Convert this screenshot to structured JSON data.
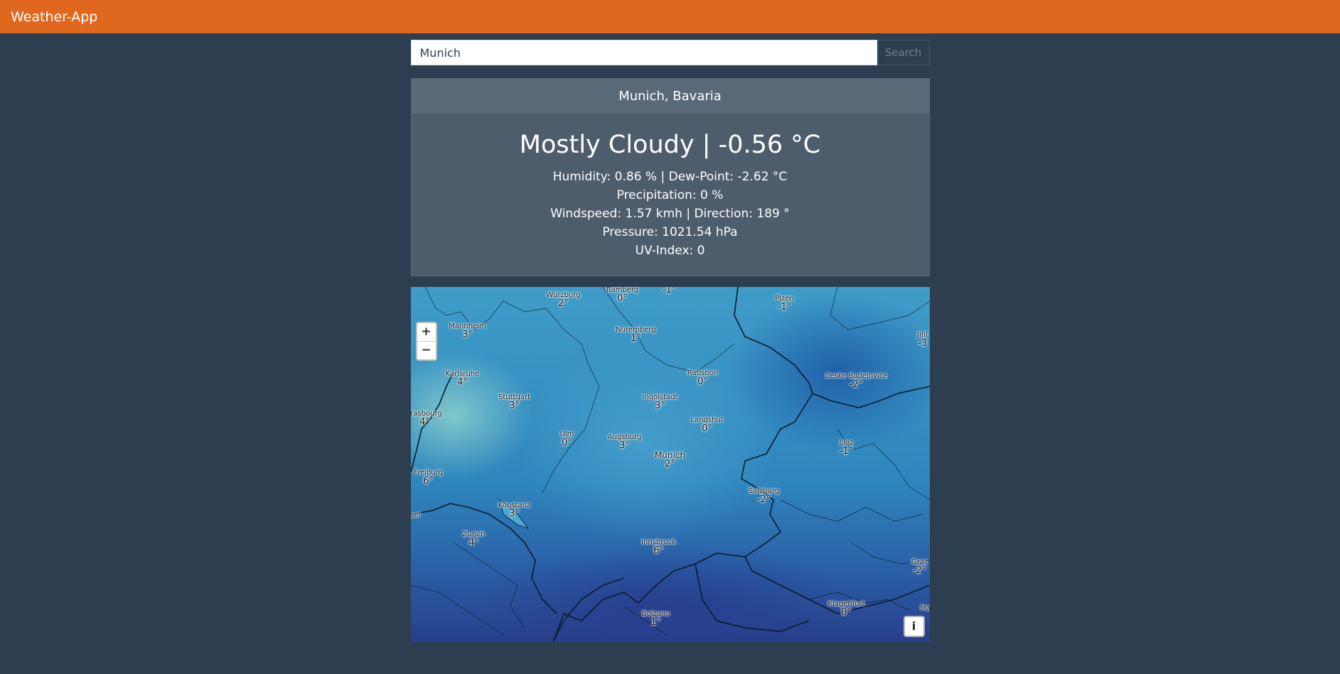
{
  "navbar": {
    "brand": "Weather-App"
  },
  "search": {
    "value": "Munich",
    "button_label": "Search"
  },
  "weather": {
    "location": "Munich, Bavaria",
    "summary": "Mostly Cloudy | -0.56 °C",
    "humidity_line": "Humidity: 0.86 % | Dew-Point: -2.62 °C",
    "precipitation_line": "Precipitation: 0 %",
    "wind_line": "Windspeed: 1.57 kmh | Direction: 189 °",
    "pressure_line": "Pressure: 1021.54 hPa",
    "uv_line": "UV-Index: 0"
  },
  "map": {
    "zoom_in_label": "+",
    "zoom_out_label": "−",
    "info_label": "i",
    "cities": [
      {
        "name": "Würzburg",
        "temp": "2°"
      },
      {
        "name": "Bamberg",
        "temp": "0°"
      },
      {
        "name": "",
        "temp": "-1°"
      },
      {
        "name": "Plzen",
        "temp": "-1°"
      },
      {
        "name": "Jihl",
        "temp": "-3"
      },
      {
        "name": "Mannheim",
        "temp": "3°"
      },
      {
        "name": "Nuremberg",
        "temp": "1°"
      },
      {
        "name": "Karlsruhe",
        "temp": "4°"
      },
      {
        "name": "Ratisbon",
        "temp": "0°"
      },
      {
        "name": "Ceske Budejovice",
        "temp": "-2°"
      },
      {
        "name": "Stuttgart",
        "temp": "3°"
      },
      {
        "name": "Ingolstadt",
        "temp": "3°"
      },
      {
        "name": "trasbourg",
        "temp": "4°"
      },
      {
        "name": "Landshut",
        "temp": "0°"
      },
      {
        "name": "Ulm",
        "temp": "0°"
      },
      {
        "name": "Augsburg",
        "temp": "3°"
      },
      {
        "name": "Linz",
        "temp": "-1°"
      },
      {
        "name": "Munich",
        "temp": "2°"
      },
      {
        "name": "Freiburg",
        "temp": "6°"
      },
      {
        "name": "Salzburg",
        "temp": "-2°"
      },
      {
        "name": "Konstanz",
        "temp": "3°"
      },
      {
        "name": "sel",
        "temp": ""
      },
      {
        "name": "Zurich",
        "temp": "4°"
      },
      {
        "name": "Innsbruck",
        "temp": "6°"
      },
      {
        "name": "Graz",
        "temp": "-2°"
      },
      {
        "name": "Klagenfurt",
        "temp": "0°"
      },
      {
        "name": "Bolzano",
        "temp": "1°"
      },
      {
        "name": "Ma",
        "temp": ""
      }
    ]
  }
}
